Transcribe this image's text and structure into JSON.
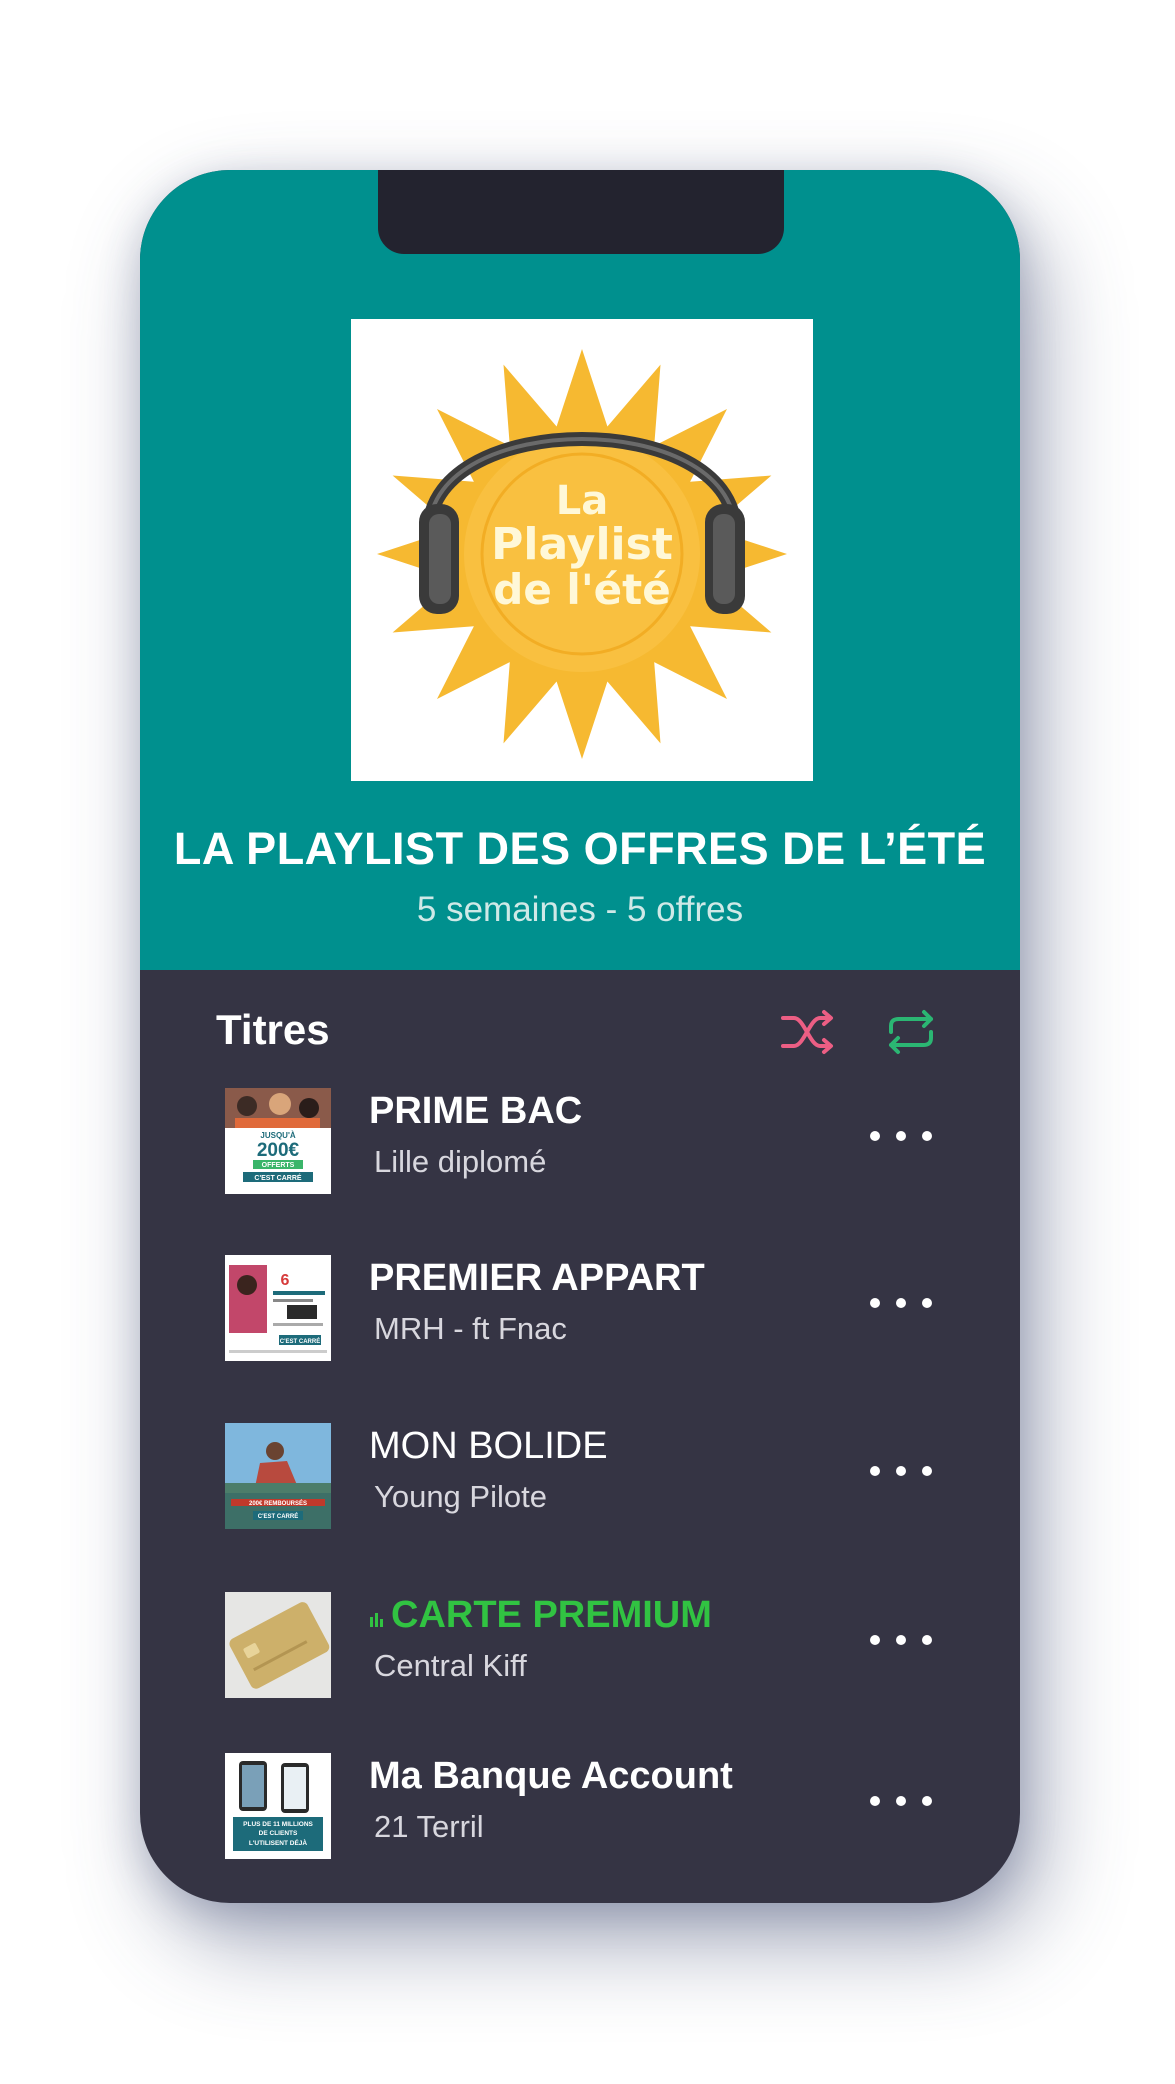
{
  "playlist": {
    "cover_lettering": [
      "La",
      "Playlist",
      "de l'été"
    ],
    "title": "LA PLAYLIST DES OFFRES DE L’ÉTÉ",
    "subtitle": "5 semaines - 5 offres"
  },
  "tracks_section": {
    "label": "Titres",
    "shuffle_icon": "shuffle-icon",
    "repeat_icon": "repeat-icon",
    "colors": {
      "shuffle": "#ec5e84",
      "repeat": "#2bb673"
    }
  },
  "tracks": [
    {
      "title": "PRIME BAC",
      "artist": "Lille diplomé",
      "thumb_text": [
        "JUSQU'À",
        "200€",
        "OFFERTS",
        "C'EST CARRÉ"
      ]
    },
    {
      "title": "PREMIER APPART",
      "artist": "MRH - ft Fnac",
      "thumb_text": [
        "6",
        "C'EST CARRÉ"
      ]
    },
    {
      "title": "MON BOLIDE",
      "artist": "Young Pilote",
      "thumb_text": [
        "200€ REMBOURSÉS",
        "C'EST CARRÉ"
      ]
    },
    {
      "title": "CARTE PREMIUM",
      "artist": "Central Kiff",
      "playing": true
    },
    {
      "title": "Ma Banque Account",
      "artist": "21 Terril",
      "thumb_text": [
        "PLUS DE 11 MILLIONS",
        "DE CLIENTS",
        "L'UTILISENT DÉJÀ"
      ]
    }
  ],
  "theme": {
    "header_bg": "#00908e",
    "list_bg": "#353444",
    "playing_color": "#31c342"
  }
}
